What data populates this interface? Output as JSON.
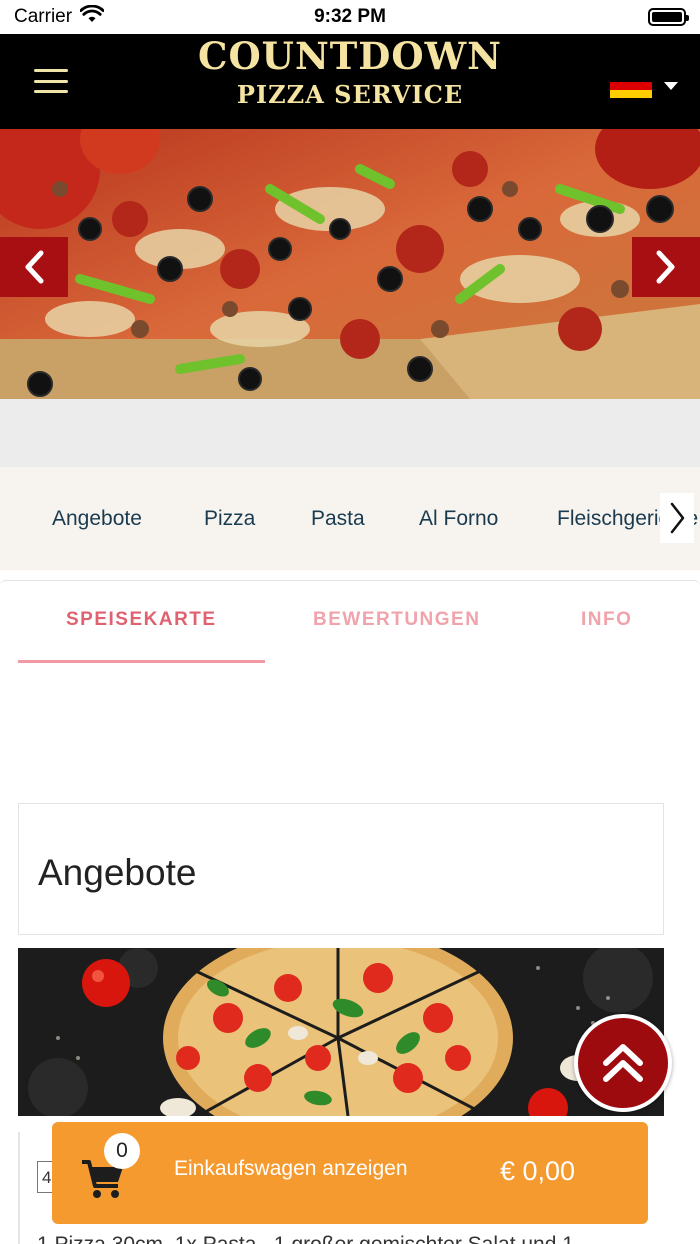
{
  "status_bar": {
    "carrier": "Carrier",
    "time": "9:32 PM"
  },
  "header": {
    "logo_line1": "COUNTDOWN",
    "logo_line2": "PIZZA SERVICE",
    "language_flag": "germany-flag",
    "colors": {
      "header_bg": "#000000",
      "logo": "#f4e3a1"
    }
  },
  "hero": {
    "image": "pizza-slice-photo",
    "prev_icon": "chevron-left-icon",
    "next_icon": "chevron-right-icon",
    "button_color": "#a70f12"
  },
  "categories": [
    "Angebote",
    "Pizza",
    "Pasta",
    "Al Forno",
    "Fleischgerichte"
  ],
  "tabs": [
    {
      "label": "SPEISEKARTE",
      "active": true
    },
    {
      "label": "BEWERTUNGEN",
      "active": false
    },
    {
      "label": "INFO",
      "active": false
    }
  ],
  "section": {
    "title": "Angebote",
    "image": "pizza-top-view-photo",
    "item": {
      "quantity": "4",
      "description": "1 Pizza 30cm, 1x Pasta , 1 großer gemischter Salat und 1"
    }
  },
  "cart": {
    "count": "0",
    "label": "Einkaufswagen anzeigen",
    "total": "€ 0,00",
    "color": "#f59a2e"
  },
  "scroll_top": {
    "icon": "double-chevron-up-icon",
    "color": "#9e0b0f"
  }
}
